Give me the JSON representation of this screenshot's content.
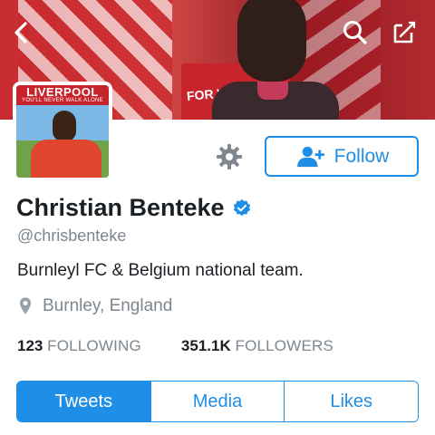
{
  "header": {
    "banner_caption": "FOR W",
    "back_icon": "chevron-left-icon",
    "search_icon": "search-icon",
    "compose_icon": "compose-icon"
  },
  "avatar": {
    "banner_top": "LIVERPOOL",
    "banner_sub": "YOU'LL NEVER WALK ALONE"
  },
  "actions": {
    "settings_icon": "gear-icon",
    "follow_label": "Follow",
    "follow_icon": "add-user-icon"
  },
  "profile": {
    "name": "Christian Benteke",
    "verified": true,
    "handle": "@chrisbenteke",
    "bio": "Burnleyl FC & Belgium national team.",
    "location": "Burnley, England"
  },
  "stats": {
    "following_count": "123",
    "following_label": "FOLLOWING",
    "followers_count": "351.1K",
    "followers_label": "FOLLOWERS"
  },
  "tabs": [
    {
      "label": "Tweets",
      "active": true
    },
    {
      "label": "Media",
      "active": false
    },
    {
      "label": "Likes",
      "active": false
    }
  ],
  "colors": {
    "accent": "#1f8ee6",
    "text": "#1b2025",
    "muted": "#7d868e"
  }
}
